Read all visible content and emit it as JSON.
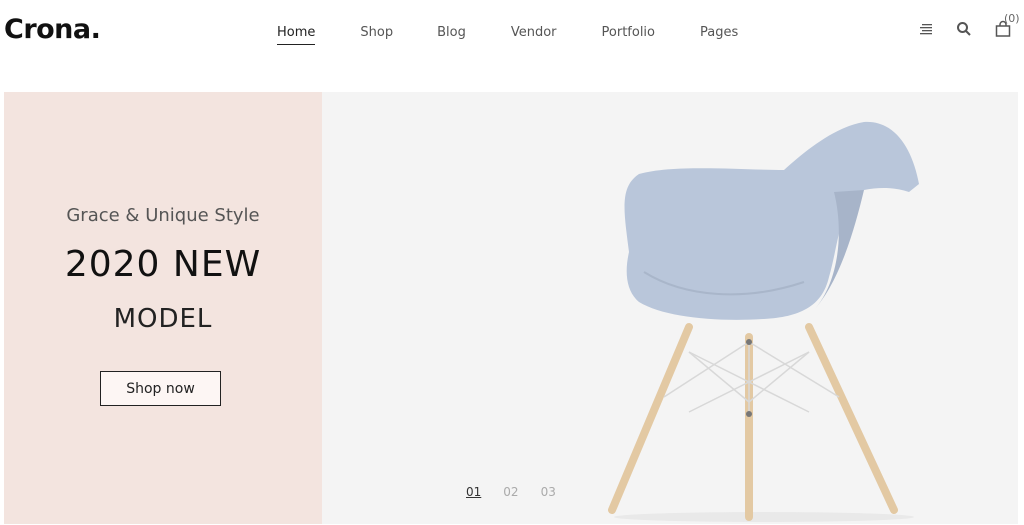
{
  "header": {
    "logo": "Crona.",
    "nav": [
      {
        "label": "Home",
        "active": true
      },
      {
        "label": "Shop"
      },
      {
        "label": "Blog"
      },
      {
        "label": "Vendor"
      },
      {
        "label": "Portfolio"
      },
      {
        "label": "Pages"
      }
    ],
    "icons": [
      "menu-icon",
      "search-icon",
      "cart-icon"
    ],
    "cart_count": "(0)"
  },
  "hero": {
    "kicker": "Grace & Unique Style",
    "headline": "2020 NEW",
    "subline": "MODEL",
    "cta": "Shop now",
    "slides": [
      "01",
      "02",
      "03"
    ],
    "active_slide": "01"
  },
  "colors": {
    "hero_left_bg": "#f3e4df",
    "hero_bg": "#f4f4f4",
    "chair_shell": "#b9c6da",
    "chair_legs": "#e3c9a3"
  }
}
